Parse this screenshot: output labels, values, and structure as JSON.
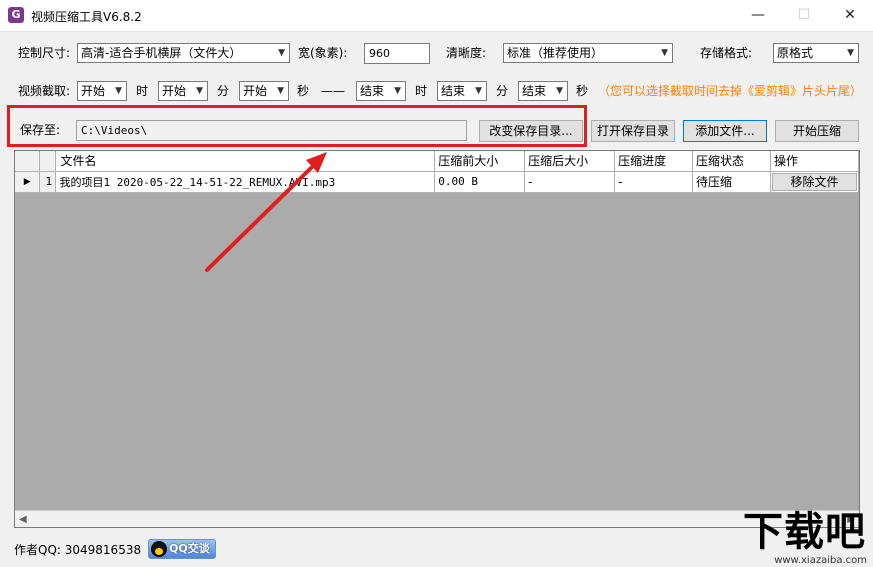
{
  "window": {
    "title": "视频压缩工具V6.8.2",
    "icon_letter": "G",
    "minimize": "—",
    "maximize": "☐",
    "close": "✕"
  },
  "settings": {
    "size_label": "控制尺寸:",
    "size_value": "高清-适合手机横屏（文件大）",
    "width_label": "宽(象素):",
    "width_value": "960",
    "clarity_label": "清晰度:",
    "clarity_value": "标准（推荐使用）",
    "format_label": "存储格式:",
    "format_value": "原格式"
  },
  "trim": {
    "label": "视频截取:",
    "start_hour": "开始",
    "hour_label": "时",
    "start_min": "开始",
    "min_label": "分",
    "start_sec": "开始",
    "sec_label": "秒",
    "dash": "——",
    "end_hour": "结束",
    "hour_label2": "时",
    "end_min": "结束",
    "min_label2": "分",
    "end_sec": "结束",
    "sec_label2": "秒",
    "hint": "（您可以选择截取时间去掉《爱剪辑》片头片尾）"
  },
  "save": {
    "label": "保存至:",
    "path": "C:\\Videos\\",
    "change_dir": "改变保存目录...",
    "open_dir": "打开保存目录",
    "add_file": "添加文件...",
    "start": "开始压缩"
  },
  "table": {
    "headers": [
      "文件名",
      "压缩前大小",
      "压缩后大小",
      "压缩进度",
      "压缩状态",
      "操作"
    ],
    "rows": [
      {
        "marker": "▶",
        "index": "1",
        "name": "我的项目1 2020-05-22_14-51-22_REMUX.AVI.mp3",
        "size_before": "0.00 B",
        "size_after": "-",
        "progress": "-",
        "status": "待压缩",
        "action": "移除文件"
      }
    ]
  },
  "footer": {
    "author_label": "作者QQ: 3049816538",
    "qq_button": "QQ交谈"
  },
  "watermark": {
    "text": "下载吧",
    "url": "www.xiazaiba.com"
  },
  "colors": {
    "highlight_box": "#e01e1e",
    "arrow": "#e01e1e",
    "hint_text": "#ff8000",
    "grid_background": "#ababab"
  }
}
